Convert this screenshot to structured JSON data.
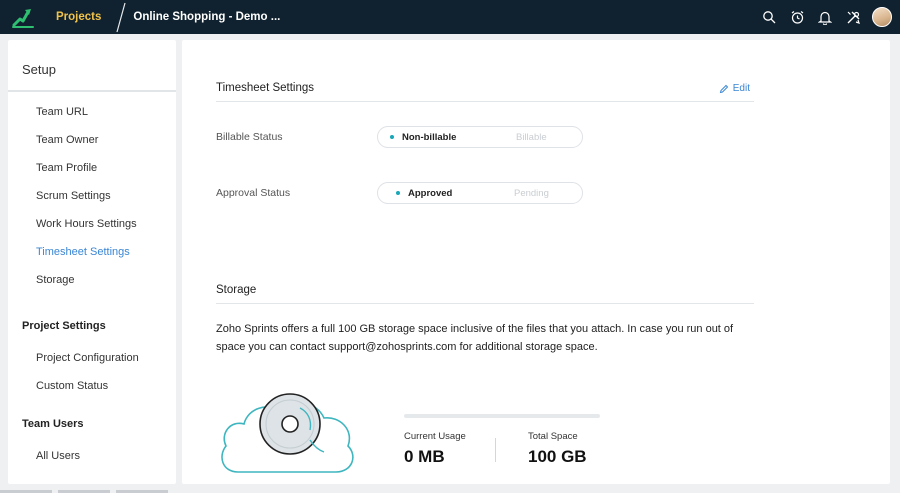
{
  "topbar": {
    "app_tab": "Projects",
    "project_name": "Online Shopping - Demo ...",
    "icons": [
      "search-icon",
      "timer-icon",
      "bell-icon",
      "tools-icon"
    ]
  },
  "sidebar": {
    "title": "Setup",
    "setup_items": [
      {
        "label": "Team URL"
      },
      {
        "label": "Team Owner"
      },
      {
        "label": "Team Profile"
      },
      {
        "label": "Scrum Settings"
      },
      {
        "label": "Work Hours Settings"
      },
      {
        "label": "Timesheet Settings",
        "active": true
      },
      {
        "label": "Storage"
      }
    ],
    "project_settings": {
      "heading": "Project Settings",
      "items": [
        {
          "label": "Project Configuration"
        },
        {
          "label": "Custom Status"
        }
      ]
    },
    "team_users": {
      "heading": "Team Users",
      "items": [
        {
          "label": "All Users"
        }
      ]
    }
  },
  "timesheet": {
    "heading": "Timesheet Settings",
    "edit_label": "Edit",
    "billable": {
      "label": "Billable Status",
      "selected": "Non-billable",
      "other": "Billable"
    },
    "approval": {
      "label": "Approval Status",
      "selected": "Approved",
      "other": "Pending"
    }
  },
  "storage": {
    "heading": "Storage",
    "description": "Zoho Sprints offers a full 100 GB storage space inclusive of the files that you attach. In case you run out of space you can contact support@zohosprints.com for additional storage space.",
    "current_usage_label": "Current Usage",
    "current_usage_value": "0 MB",
    "total_space_label": "Total Space",
    "total_space_value": "100 GB",
    "usage_fraction": 0
  },
  "colors": {
    "topbar": "#10222f",
    "accent": "#3a86d4",
    "projects_tab": "#f0c24a",
    "toggle_dot": "#19a7b8"
  }
}
